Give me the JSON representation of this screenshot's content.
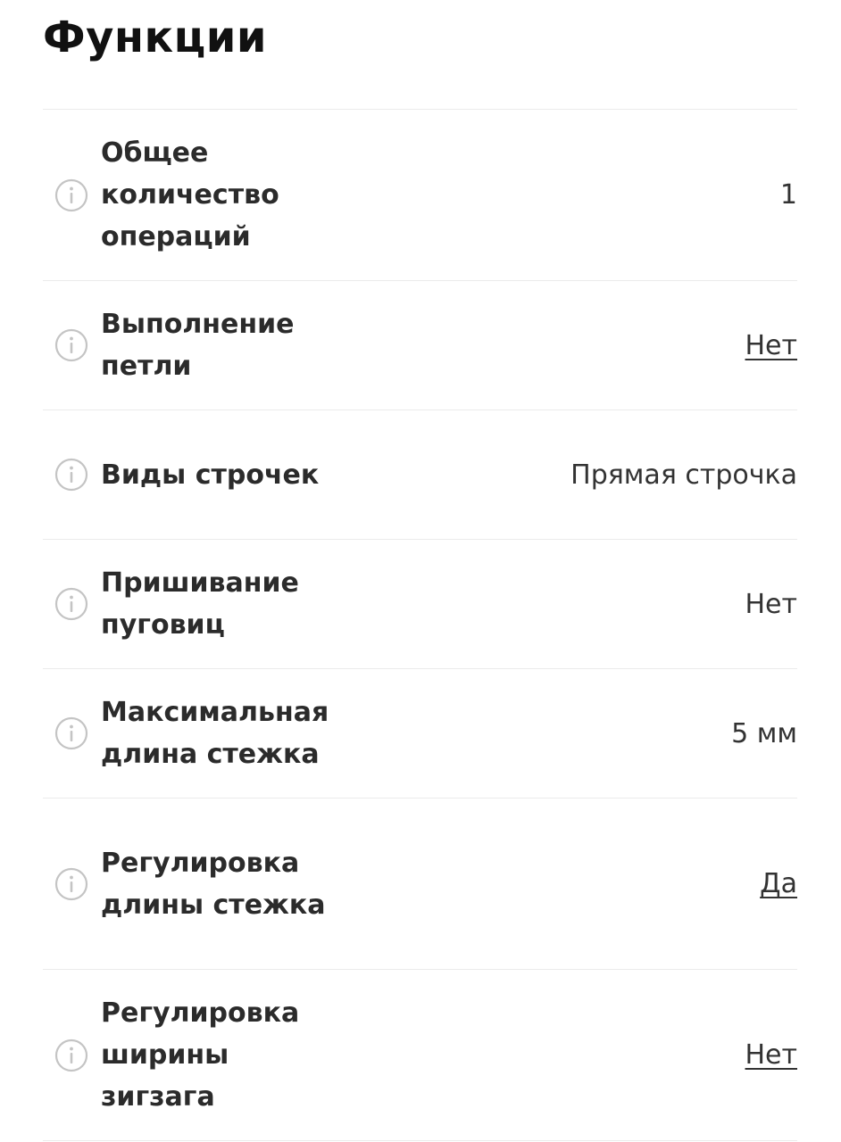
{
  "section": {
    "title": "Функции"
  },
  "specs": [
    {
      "label": "Общее количество операций",
      "value": "1",
      "value_is_link": false,
      "icon": "info-icon"
    },
    {
      "label": "Выполнение петли",
      "value": "Нет",
      "value_is_link": true,
      "icon": "info-icon"
    },
    {
      "label": "Виды строчек",
      "value": "Прямая строчка",
      "value_is_link": false,
      "icon": "info-icon"
    },
    {
      "label": "Пришивание пуговиц",
      "value": "Нет",
      "value_is_link": false,
      "icon": "info-icon"
    },
    {
      "label": "Максимальная длина стежка",
      "value": "5 мм",
      "value_is_link": false,
      "icon": "info-icon"
    },
    {
      "label": "Регулировка длины стежка",
      "value": "Да",
      "value_is_link": true,
      "icon": "info-icon"
    },
    {
      "label": "Регулировка ширины зигзага",
      "value": "Нет",
      "value_is_link": true,
      "icon": "info-icon"
    }
  ],
  "colors": {
    "text": "#2b2b2b",
    "divider": "#ebebeb",
    "icon": "#c4c4c4"
  }
}
